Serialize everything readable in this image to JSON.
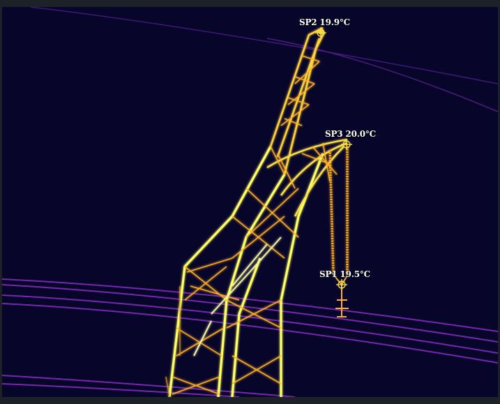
{
  "spots": [
    {
      "id": "sp2",
      "label": "SP2 19.9°C",
      "color": "#f6e04a"
    },
    {
      "id": "sp3",
      "label": "SP3 20.0°C",
      "color": "#f6e04a"
    },
    {
      "id": "sp1",
      "label": "SP1 19.5°C",
      "color": "#f6e04a"
    }
  ],
  "colors": {
    "background": "#07052a",
    "frame": "#1c2228",
    "hot": "#ffff55",
    "warm": "#f0a020",
    "mid": "#c8551e",
    "cool_wire": "#8a2cc8"
  }
}
